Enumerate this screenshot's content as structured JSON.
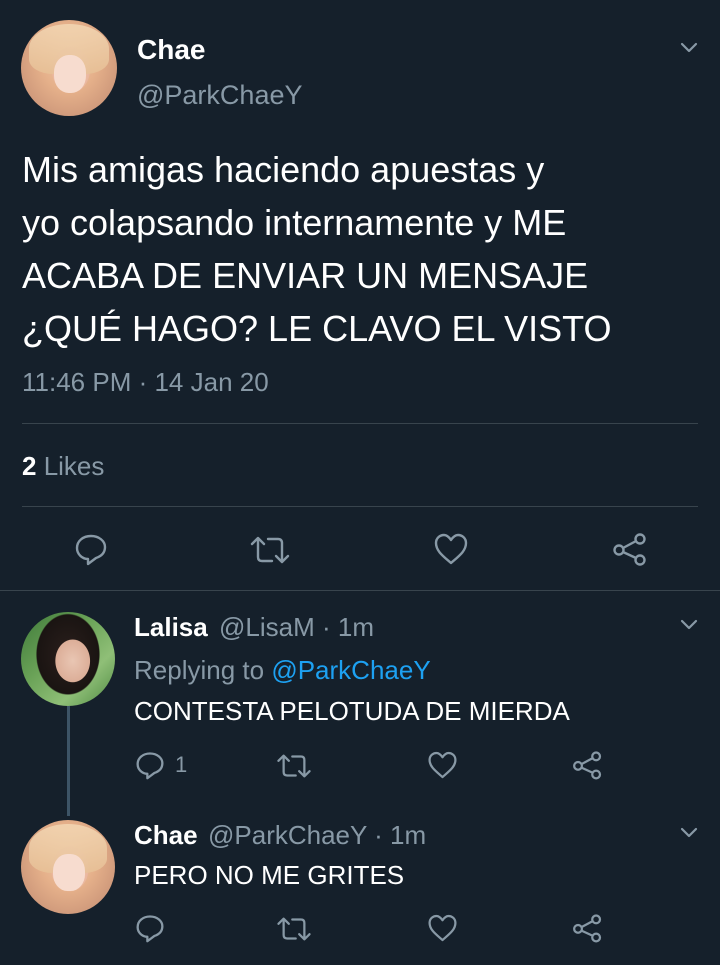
{
  "main_tweet": {
    "author_name": "Chae",
    "author_handle": "@ParkChaeY",
    "text_lines": [
      "Mis amigas haciendo apuestas y",
      "yo colapsando internamente y ME",
      "ACABA DE ENVIAR UN MENSAJE",
      "¿QUÉ HAGO? LE CLAVO EL VISTO"
    ],
    "timestamp": "11:46 PM · 14 Jan 20",
    "likes_count": "2",
    "likes_label": " Likes"
  },
  "replies": [
    {
      "author_name": "Lalisa",
      "meta": "@LisaM · 1m",
      "replying_prefix": "Replying to ",
      "replying_to": "@ParkChaeY",
      "text": "CONTESTA PELOTUDA DE MIERDA",
      "reply_count": "1"
    },
    {
      "author_name": "Chae",
      "meta": "@ParkChaeY · 1m",
      "text": "PERO NO ME GRITES"
    }
  ],
  "colors": {
    "background": "#15202b",
    "text": "#ffffff",
    "secondary": "#8899a6",
    "separator": "#38444d",
    "link": "#1da1f2"
  },
  "icons": [
    "chevron-down-icon",
    "reply-icon",
    "retweet-icon",
    "like-icon",
    "share-icon"
  ]
}
